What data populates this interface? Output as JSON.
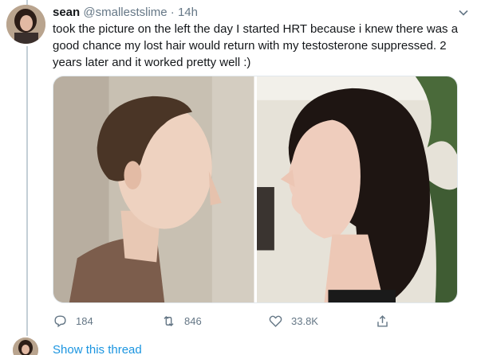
{
  "tweet": {
    "author_name": "sean",
    "author_handle": "@smallestslime",
    "separator": "·",
    "timestamp": "14h",
    "text": "took the picture on the left the day I started HRT because i knew there was a good chance my lost hair would return with my testosterone suppressed. 2 years later and it worked pretty well :)",
    "media": [
      {
        "icon": "photo-left-profile"
      },
      {
        "icon": "photo-right-profile"
      }
    ],
    "actions": {
      "reply_count": "184",
      "retweet_count": "846",
      "like_count": "33.8K"
    }
  },
  "thread": {
    "show_label": "Show this thread"
  },
  "colors": {
    "link": "#1b95e0",
    "muted": "#657786",
    "thread_line": "#c4cfd6"
  }
}
